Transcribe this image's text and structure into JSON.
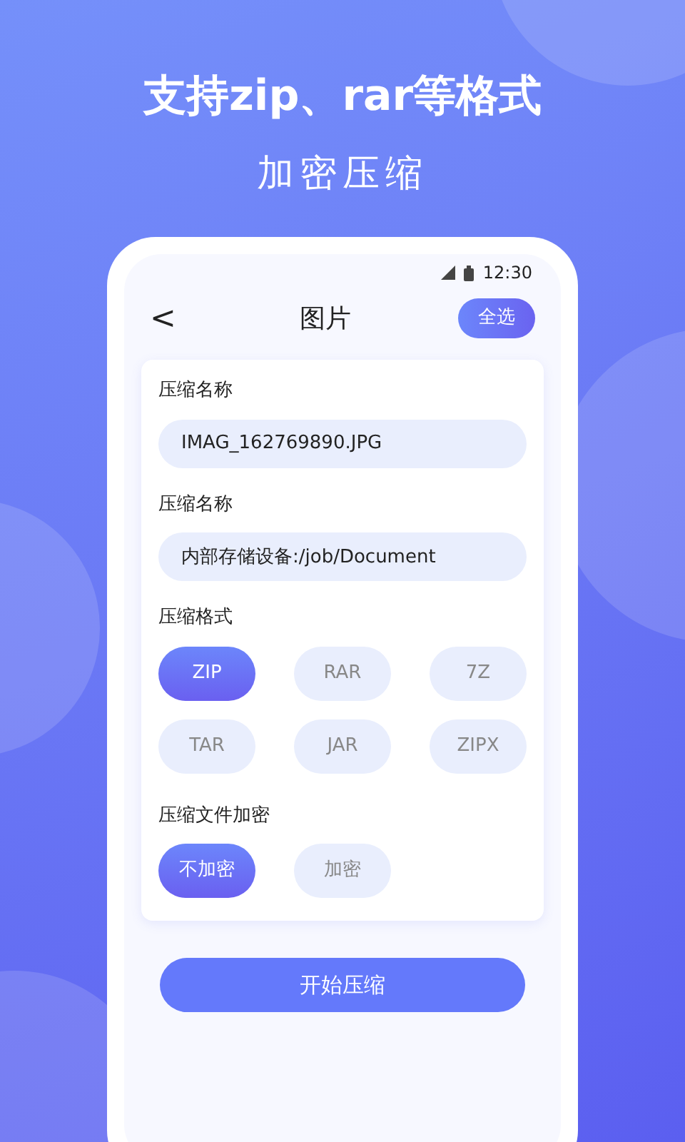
{
  "headline": "支持zip、rar等格式",
  "subtitle": "加密压缩",
  "status_bar": {
    "time": "12:30"
  },
  "header": {
    "back": "<",
    "title": "图片",
    "action": "全选"
  },
  "fields": [
    {
      "label": "压缩名称",
      "value": "IMAG_162769890.JPG"
    },
    {
      "label": "压缩名称",
      "value": "内部存储设备:/job/Document"
    }
  ],
  "format": {
    "label": "压缩格式",
    "options": [
      {
        "label": "ZIP",
        "selected": true
      },
      {
        "label": "RAR",
        "selected": false
      },
      {
        "label": "7Z",
        "selected": false
      },
      {
        "label": "TAR",
        "selected": false
      },
      {
        "label": "JAR",
        "selected": false
      },
      {
        "label": "ZIPX",
        "selected": false
      }
    ]
  },
  "encryption": {
    "label": "压缩文件加密",
    "options": [
      {
        "label": "不加密",
        "selected": true
      },
      {
        "label": "加密",
        "selected": false
      }
    ]
  },
  "start_button": "开始压缩"
}
